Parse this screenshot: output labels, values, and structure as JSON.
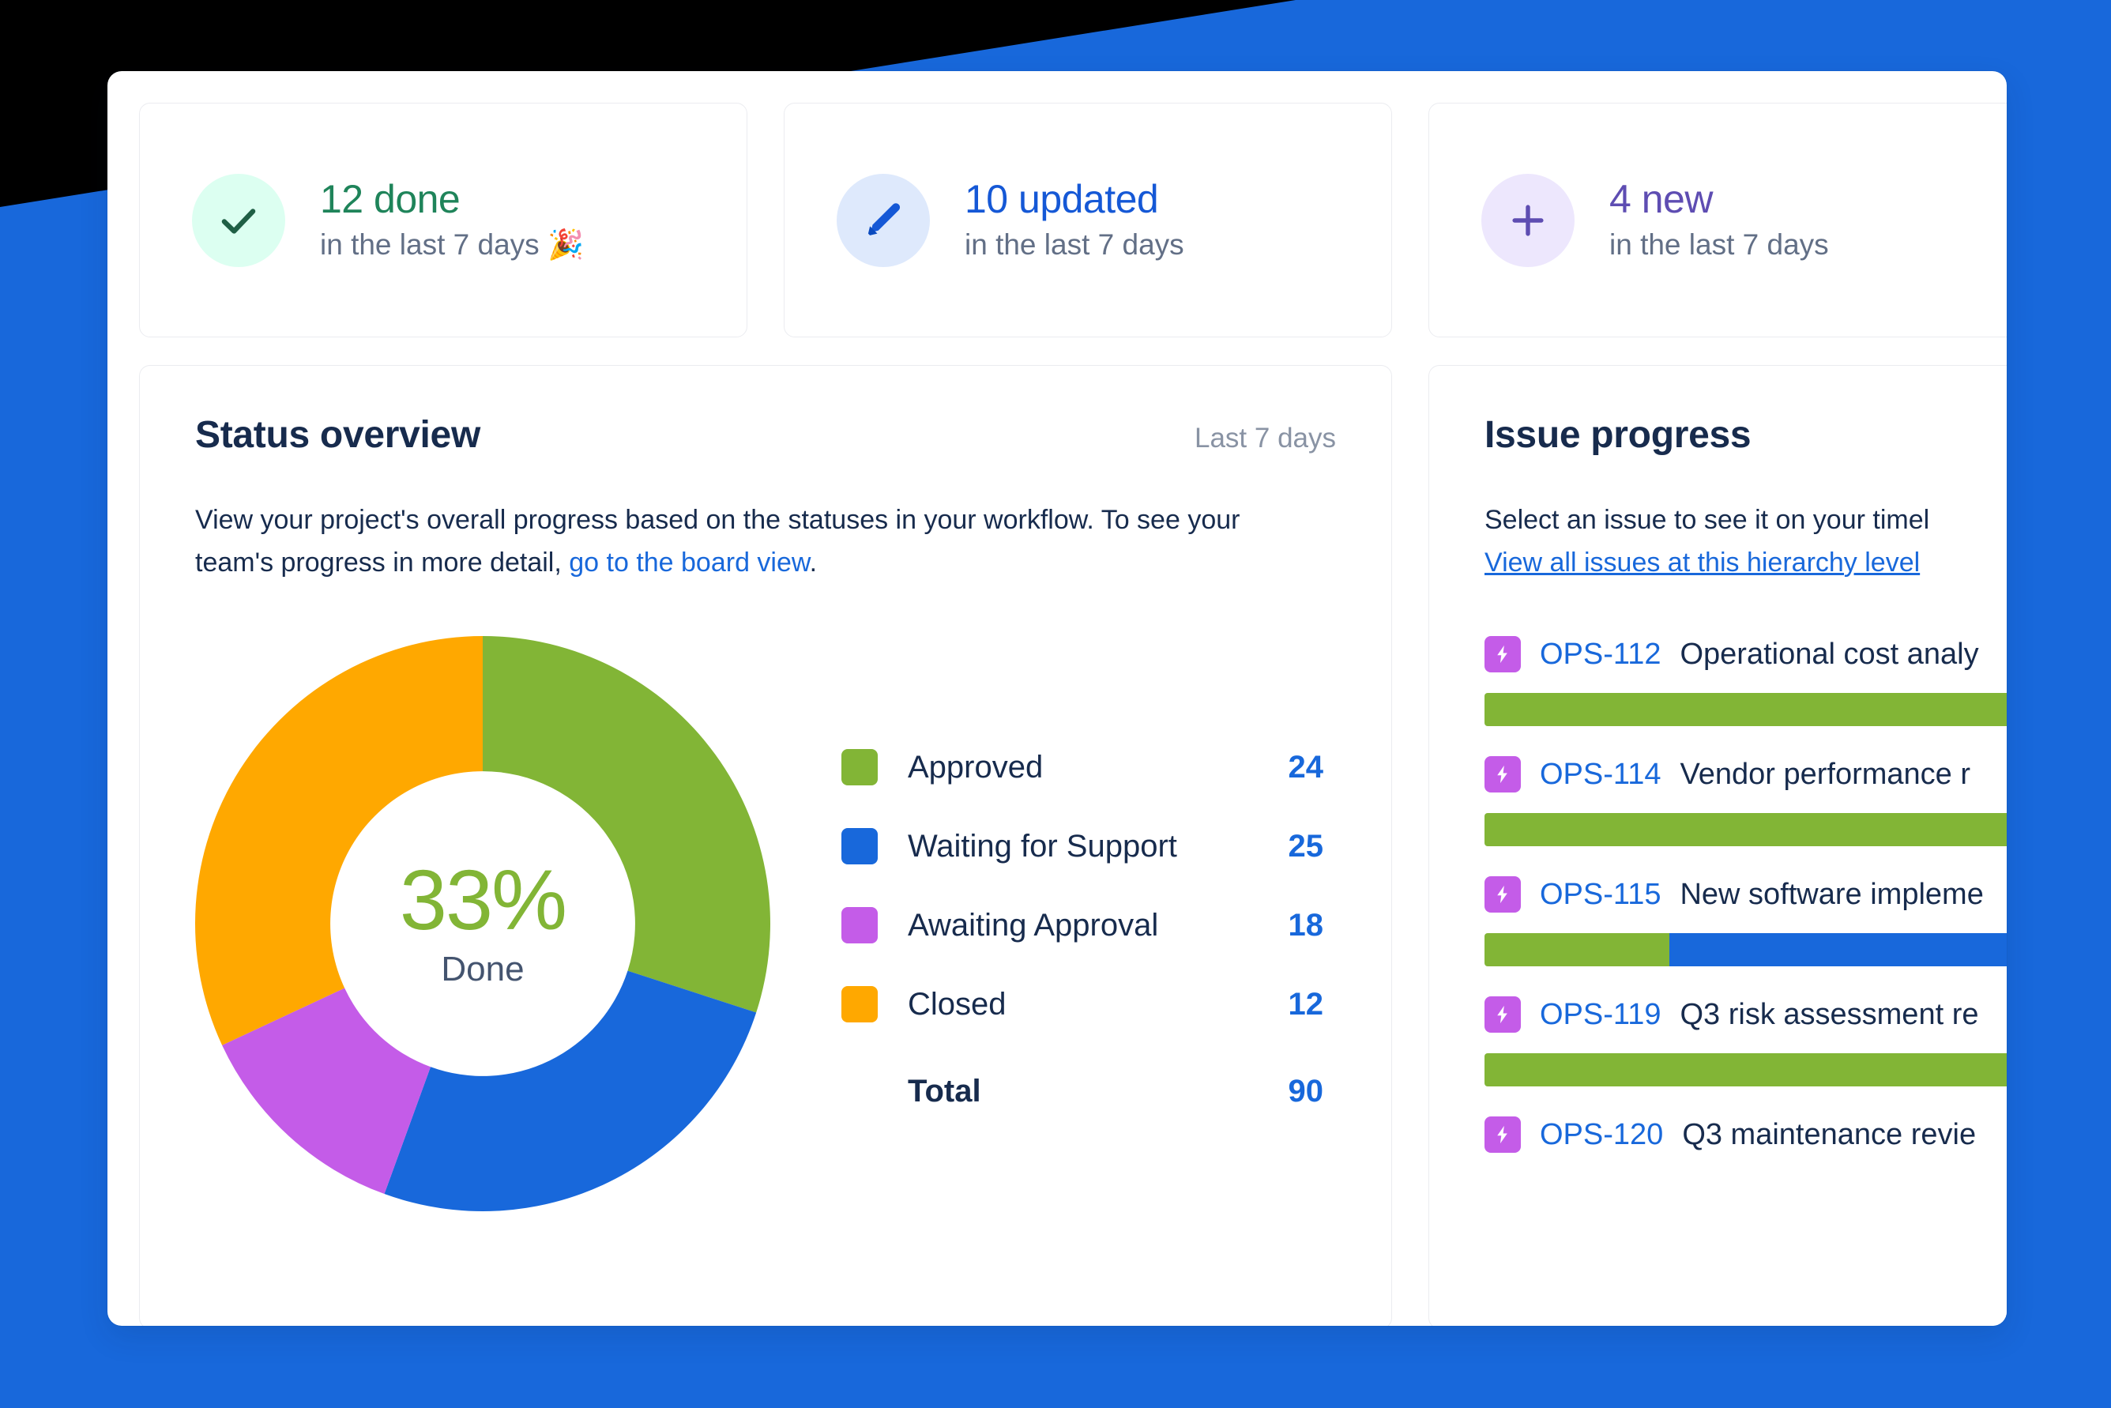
{
  "stats": [
    {
      "icon": "check-icon",
      "headline": "12 done",
      "sub": "in the last 7 days 🎉",
      "accent": "#1F845A",
      "bubble": "#DCFFF1"
    },
    {
      "icon": "pencil-icon",
      "headline": "10 updated",
      "sub": "in the last 7 days",
      "accent": "#1558D6",
      "bubble": "#DEE9FC"
    },
    {
      "icon": "plus-icon",
      "headline": "4 new",
      "sub": "in the last 7 days",
      "accent": "#5E4DB2",
      "bubble": "#EDE7FD"
    }
  ],
  "status_card": {
    "title": "Status overview",
    "period": "Last 7 days",
    "desc_part1": "View your project's overall progress based on the statuses in your workflow. To see your team's progress in more detail, ",
    "desc_link": "go to the board view",
    "desc_part2": ".",
    "donut_percent": "33%",
    "donut_label": "Done",
    "total_label": "Total",
    "total_value": "90"
  },
  "chart_data": {
    "type": "pie",
    "title": "Status overview",
    "subtitle": "Last 7 days",
    "center_value": "33%",
    "center_label": "Done",
    "categories": [
      "Approved",
      "Waiting for Support",
      "Awaiting Approval",
      "Closed"
    ],
    "values": [
      24,
      25,
      18,
      12
    ],
    "colors": [
      "#82B536",
      "#1868DB",
      "#C45CE8",
      "#FFA800"
    ],
    "angles_deg": [
      108,
      92,
      45,
      115
    ],
    "total": 90,
    "legend_position": "right",
    "donut_hole_ratio": 0.53
  },
  "progress_card": {
    "title": "Issue progress",
    "desc": "Select an issue to see it on your timel",
    "link": "View all issues at this hierarchy level",
    "issues": [
      {
        "type_icon": "epic-bolt-icon",
        "key": "OPS-112",
        "summary": "Operational cost analy",
        "segments": [
          {
            "color": "#82B536",
            "pct": 100
          }
        ]
      },
      {
        "type_icon": "epic-bolt-icon",
        "key": "OPS-114",
        "summary": "Vendor performance r",
        "segments": [
          {
            "color": "#82B536",
            "pct": 100
          }
        ]
      },
      {
        "type_icon": "epic-bolt-icon",
        "key": "OPS-115",
        "summary": "New software impleme",
        "segments": [
          {
            "color": "#82B536",
            "pct": 26
          },
          {
            "color": "#1868DB",
            "pct": 74
          }
        ]
      },
      {
        "type_icon": "epic-bolt-icon",
        "key": "OPS-119",
        "summary": "Q3 risk assessment re",
        "segments": [
          {
            "color": "#82B536",
            "pct": 100
          }
        ]
      },
      {
        "type_icon": "epic-bolt-icon",
        "key": "OPS-120",
        "summary": "Q3 maintenance revie",
        "segments": []
      }
    ]
  },
  "theme": {
    "brand_blue": "#1868DB",
    "panel_bg": "#FFFFFF",
    "backdrop": "#000000",
    "text": "#172B4D",
    "muted": "#626F86"
  }
}
